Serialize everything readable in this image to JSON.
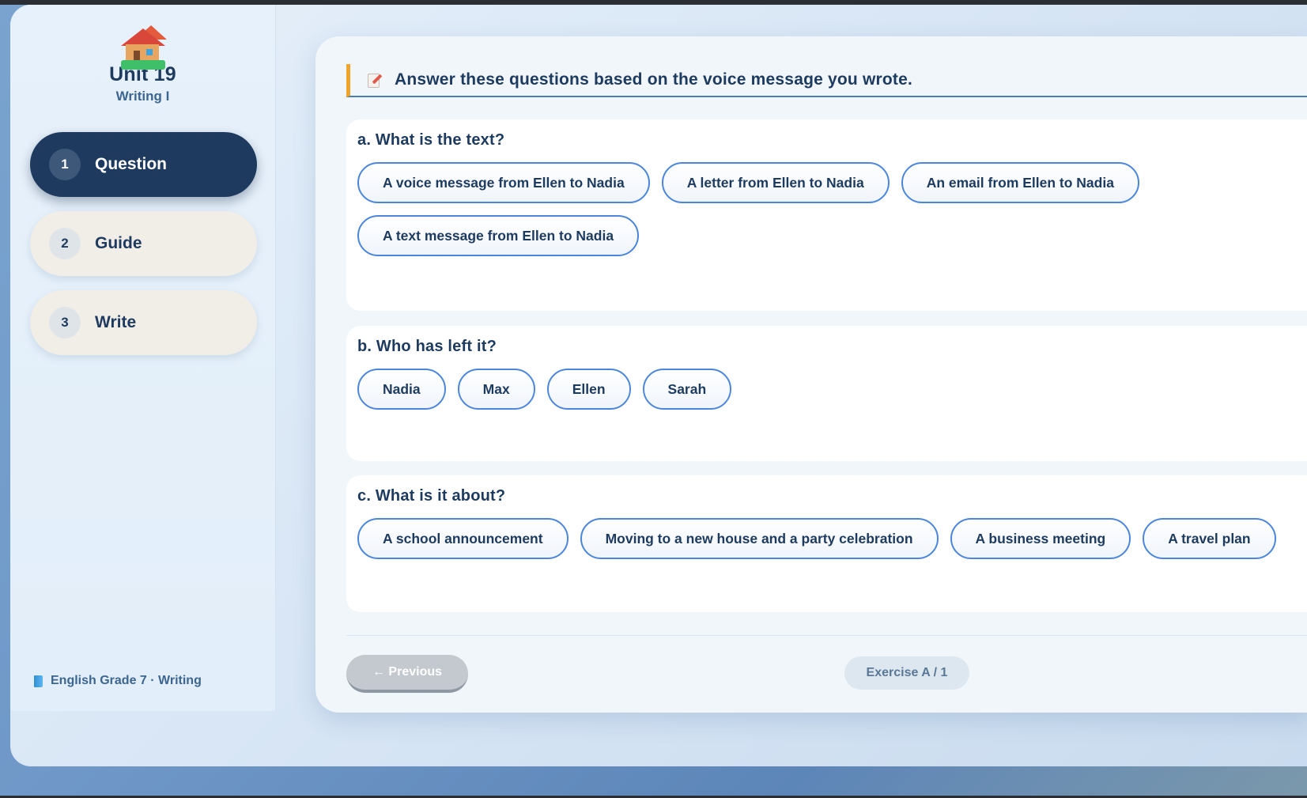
{
  "sidebar": {
    "unit_title": "Unit 19",
    "unit_subtitle": "Writing I",
    "steps": [
      {
        "number": "1",
        "label": "Question",
        "active": true
      },
      {
        "number": "2",
        "label": "Guide",
        "active": false
      },
      {
        "number": "3",
        "label": "Write",
        "active": false
      }
    ],
    "footer": "English Grade 7 · Writing"
  },
  "main": {
    "instruction": "Answer these questions based on the voice message you wrote.",
    "questions": [
      {
        "title": "a. What is the text?",
        "options": [
          "A voice message from Ellen to Nadia",
          "A letter from Ellen to Nadia",
          "An email from Ellen to Nadia",
          "A text message from Ellen to Nadia"
        ]
      },
      {
        "title": "b. Who has left it?",
        "options": [
          "Nadia",
          "Max",
          "Ellen",
          "Sarah"
        ]
      },
      {
        "title": "c. What is it about?",
        "options": [
          "A school announcement",
          "Moving to a new house and a party celebration",
          "A business meeting",
          "A travel plan"
        ]
      }
    ],
    "prev_button": "← Previous",
    "exercise_badge": "Exercise A / 1"
  },
  "colors": {
    "primary": "#1e3a5f",
    "accent_border": "#4b86dc",
    "instruction_bar": "#f0a52a"
  },
  "icons": {
    "brand": "house-icon",
    "instruction": "pencil-paper-icon",
    "footer": "book-icon"
  }
}
